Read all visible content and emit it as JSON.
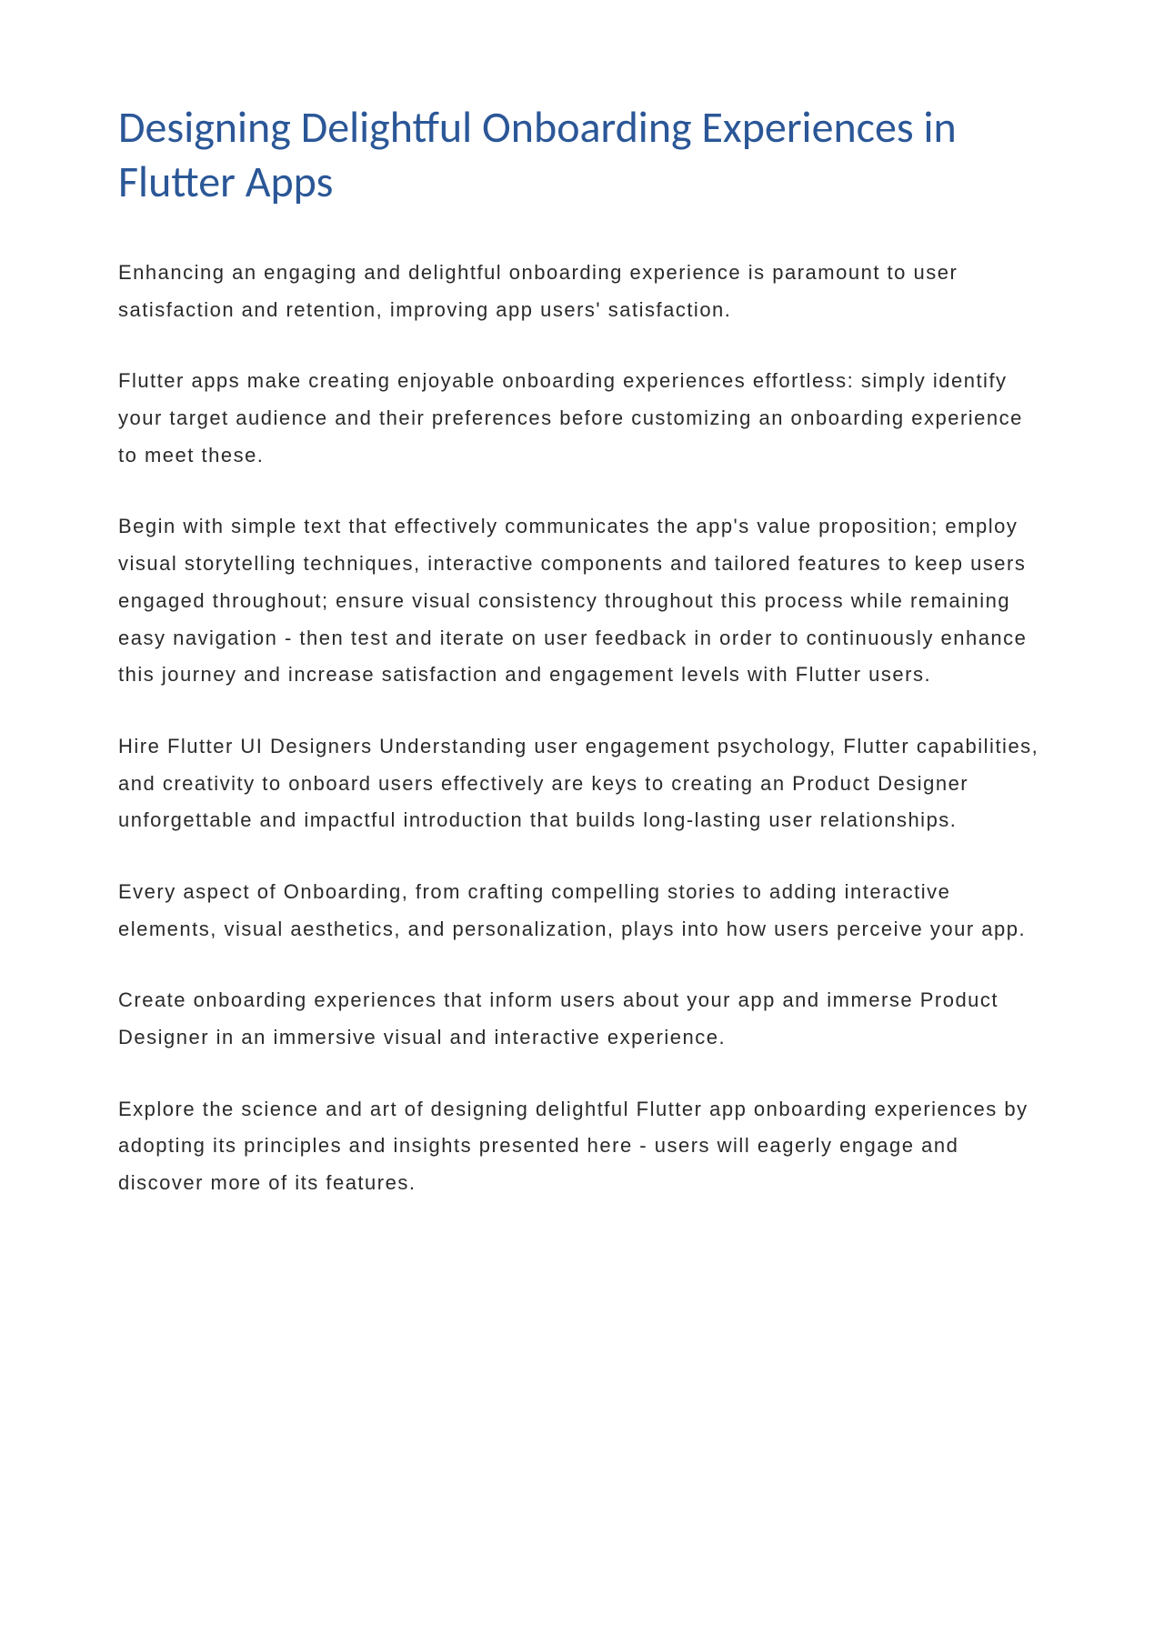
{
  "document": {
    "title": "Designing Delightful Onboarding Experiences in Flutter Apps",
    "paragraphs": [
      "Enhancing an engaging and delightful onboarding experience is paramount to user satisfaction and retention, improving app users' satisfaction.",
      "Flutter apps make creating enjoyable onboarding experiences effortless: simply identify your target audience and their preferences before customizing an onboarding experience to meet these.",
      "Begin with simple text that effectively communicates the app's value proposition; employ visual storytelling techniques, interactive components and tailored features to keep users engaged throughout; ensure visual consistency throughout this process while remaining easy navigation - then test and iterate on user feedback in order to continuously enhance this journey and increase satisfaction and engagement levels with Flutter users.",
      "Hire Flutter UI Designers Understanding user engagement psychology, Flutter capabilities, and creativity to onboard users effectively are keys to creating an Product Designer unforgettable and impactful introduction that builds long-lasting user relationships.",
      "Every aspect of Onboarding, from crafting compelling stories to adding interactive elements, visual aesthetics, and personalization, plays into how users perceive your app.",
      "Create onboarding experiences that inform users about your app and immerse Product Designer in an immersive visual and interactive experience.",
      "Explore the science and art of designing delightful Flutter app onboarding experiences by adopting its principles and insights presented here - users will eagerly engage and discover more of its features."
    ]
  }
}
